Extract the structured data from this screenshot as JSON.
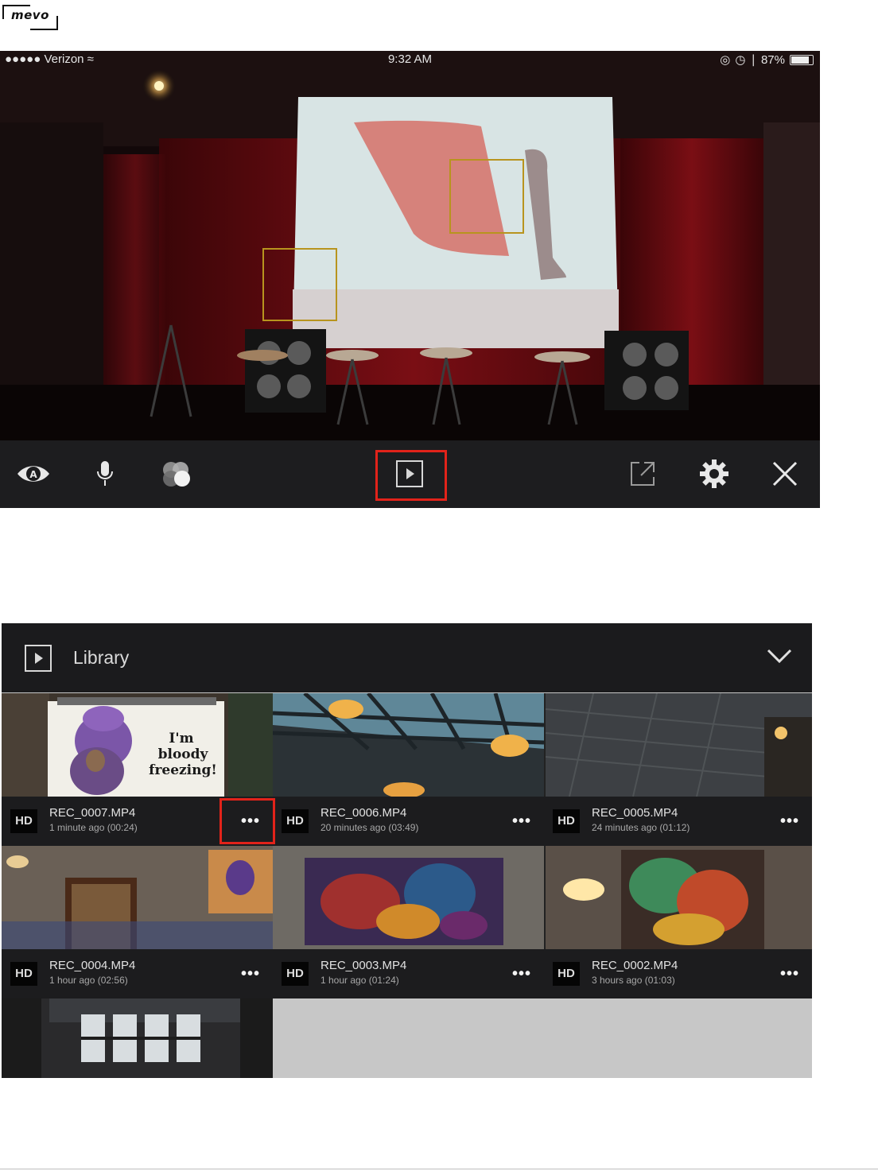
{
  "logo": {
    "text": "mevo"
  },
  "status_bar": {
    "carrier": "●●●●● Verizon",
    "time": "9:32 AM",
    "battery": "87%",
    "icons": [
      "wifi-icon",
      "lock-rotation-icon",
      "alarm-icon",
      "bluetooth-icon",
      "battery-icon"
    ]
  },
  "camera_toolbar": {
    "buttons": [
      "auto-director-eye-icon",
      "microphone-icon",
      "color-filters-icon",
      "library-play-icon",
      "share-icon",
      "settings-gear-icon",
      "close-icon"
    ],
    "highlighted": "library-play-icon",
    "highlight_color": "#e2231a"
  },
  "library": {
    "title": "Library",
    "header_icon": "library-play-icon",
    "collapse_icon": "chevron-down-icon",
    "items": [
      {
        "badge": "HD",
        "name": "REC_0007.MP4",
        "meta": "1 minute ago (00:24)",
        "more": "•••",
        "thumb_text": "I'm bloody freezing!"
      },
      {
        "badge": "HD",
        "name": "REC_0006.MP4",
        "meta": "20 minutes ago (03:49)",
        "more": "•••"
      },
      {
        "badge": "HD",
        "name": "REC_0005.MP4",
        "meta": "24 minutes ago (01:12)",
        "more": "•••"
      },
      {
        "badge": "HD",
        "name": "REC_0004.MP4",
        "meta": "1 hour ago (02:56)",
        "more": "•••"
      },
      {
        "badge": "HD",
        "name": "REC_0003.MP4",
        "meta": "1 hour ago (01:24)",
        "more": "•••"
      },
      {
        "badge": "HD",
        "name": "REC_0002.MP4",
        "meta": "3 hours ago (01:03)",
        "more": "•••"
      }
    ],
    "highlighted": "REC_0007.MP4 more button"
  }
}
